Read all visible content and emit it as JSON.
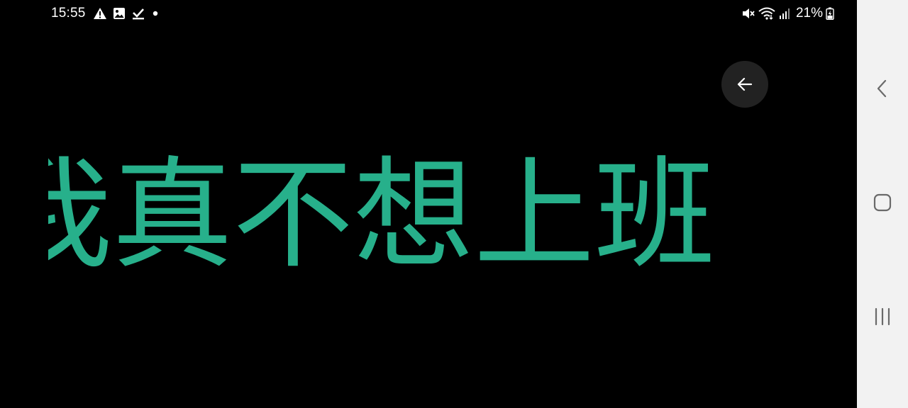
{
  "status_bar": {
    "time": "15:55",
    "battery": "21%",
    "icons_left": [
      "warning-icon",
      "image-icon",
      "download-done-icon",
      "notification-dot-icon"
    ],
    "icons_right": [
      "mute-icon",
      "wifi-icon",
      "signal-icon",
      "battery-charging-icon"
    ]
  },
  "banner": {
    "text": "我真不想上班",
    "color": "#27b08b"
  },
  "colors": {
    "background": "#000000",
    "back_button_bg": "#222222",
    "navbar_bg": "#f2f2f2",
    "nav_icon": "#6a6a6a"
  },
  "nav_bar": {
    "buttons": [
      "back-icon",
      "home-icon",
      "recents-icon"
    ]
  }
}
